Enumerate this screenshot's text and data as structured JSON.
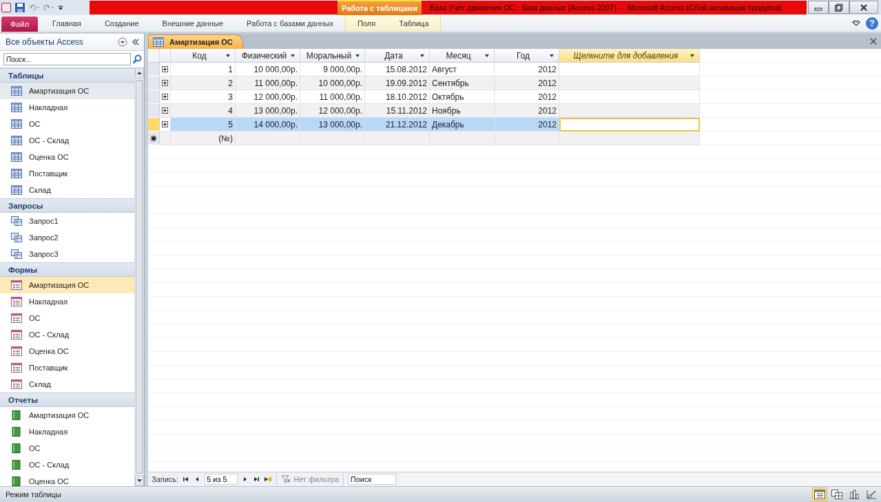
{
  "title_bar": {
    "title": "База Учёт движения ОС : база данных (Access 2007)  -  Microsoft Access (Сбой активации продукта)",
    "context_label": "Работа с таблицами"
  },
  "ribbon": {
    "tabs": [
      {
        "label": "Файл",
        "kind": "file"
      },
      {
        "label": "Главная",
        "kind": "normal"
      },
      {
        "label": "Создание",
        "kind": "normal"
      },
      {
        "label": "Внешние данные",
        "kind": "normal"
      },
      {
        "label": "Работа с базами данных",
        "kind": "normal"
      },
      {
        "label": "Поля",
        "kind": "context"
      },
      {
        "label": "Таблица",
        "kind": "context"
      }
    ],
    "help_label": "?"
  },
  "nav": {
    "title": "Все объекты Access",
    "search": {
      "placeholder": "Поиск..."
    },
    "groups": [
      {
        "label": "Таблицы",
        "kind": "table",
        "items": [
          {
            "label": "Амартизация ОС",
            "selected": false,
            "hover": true
          },
          {
            "label": "Накладная",
            "selected": false,
            "hover": false
          },
          {
            "label": "ОС",
            "selected": false,
            "hover": false
          },
          {
            "label": "ОС - Склад",
            "selected": false,
            "hover": false
          },
          {
            "label": "Оценка ОС",
            "selected": false,
            "hover": false
          },
          {
            "label": "Поставщик",
            "selected": false,
            "hover": false
          },
          {
            "label": "Склад",
            "selected": false,
            "hover": false
          }
        ]
      },
      {
        "label": "Запросы",
        "kind": "query",
        "items": [
          {
            "label": "Запрос1",
            "selected": false,
            "hover": false
          },
          {
            "label": "Запрос2",
            "selected": false,
            "hover": false
          },
          {
            "label": "Запрос3",
            "selected": false,
            "hover": false
          }
        ]
      },
      {
        "label": "Формы",
        "kind": "form",
        "items": [
          {
            "label": "Амартизация ОС",
            "selected": true,
            "hover": false
          },
          {
            "label": "Накладная",
            "selected": false,
            "hover": false
          },
          {
            "label": "ОС",
            "selected": false,
            "hover": false
          },
          {
            "label": "ОС - Склад",
            "selected": false,
            "hover": false
          },
          {
            "label": "Оценка ОС",
            "selected": false,
            "hover": false
          },
          {
            "label": "Поставщик",
            "selected": false,
            "hover": false
          },
          {
            "label": "Склад",
            "selected": false,
            "hover": false
          }
        ]
      },
      {
        "label": "Отчеты",
        "kind": "report",
        "items": [
          {
            "label": "Амартизация ОС",
            "selected": false,
            "hover": false
          },
          {
            "label": "Накладная",
            "selected": false,
            "hover": false
          },
          {
            "label": "ОС",
            "selected": false,
            "hover": false
          },
          {
            "label": "ОС - Склад",
            "selected": false,
            "hover": false
          },
          {
            "label": "Оценка ОС",
            "selected": false,
            "hover": false
          }
        ]
      }
    ]
  },
  "document_tab": {
    "label": "Амартизация ОС"
  },
  "table": {
    "columns": [
      {
        "label": "Код",
        "kind": "number"
      },
      {
        "label": "Физический",
        "kind": "number"
      },
      {
        "label": "Моральный",
        "kind": "number"
      },
      {
        "label": "Дата",
        "kind": "number"
      },
      {
        "label": "Месяц",
        "kind": "text"
      },
      {
        "label": "Год",
        "kind": "number"
      },
      {
        "label": "Щелкните для добавления",
        "kind": "add"
      }
    ],
    "rows": [
      {
        "cells": [
          "1",
          "10 000,00р.",
          "9 000,00р.",
          "15.08.2012",
          "Август",
          "2012"
        ],
        "selected": false
      },
      {
        "cells": [
          "2",
          "11 000,00р.",
          "10 000,00р.",
          "19.09.2012",
          "Сентябрь",
          "2012"
        ],
        "selected": false
      },
      {
        "cells": [
          "3",
          "12 000,00р.",
          "11 000,00р.",
          "18.10.2012",
          "Октябрь",
          "2012"
        ],
        "selected": false
      },
      {
        "cells": [
          "4",
          "13 000,00р.",
          "12 000,00р.",
          "15.11.2012",
          "Ноябрь",
          "2012"
        ],
        "selected": false
      },
      {
        "cells": [
          "5",
          "14 000,00р.",
          "13 000,00р.",
          "21.12.2012",
          "Декабрь",
          "2012"
        ],
        "selected": true
      }
    ],
    "new_row": {
      "cells": [
        "(№)"
      ]
    }
  },
  "record_nav": {
    "label": "Запись:",
    "position": "5 из 5",
    "filter": {
      "label": "Нет фильтра",
      "disabled": true
    },
    "search": {
      "placeholder": "Поиск"
    }
  },
  "status_bar": {
    "text": "Режим таблицы",
    "views": [
      {
        "kind": "datasheet",
        "selected": true
      },
      {
        "kind": "pivot-table",
        "selected": false
      },
      {
        "kind": "pivot-chart",
        "selected": false
      },
      {
        "kind": "design",
        "selected": false
      }
    ]
  }
}
